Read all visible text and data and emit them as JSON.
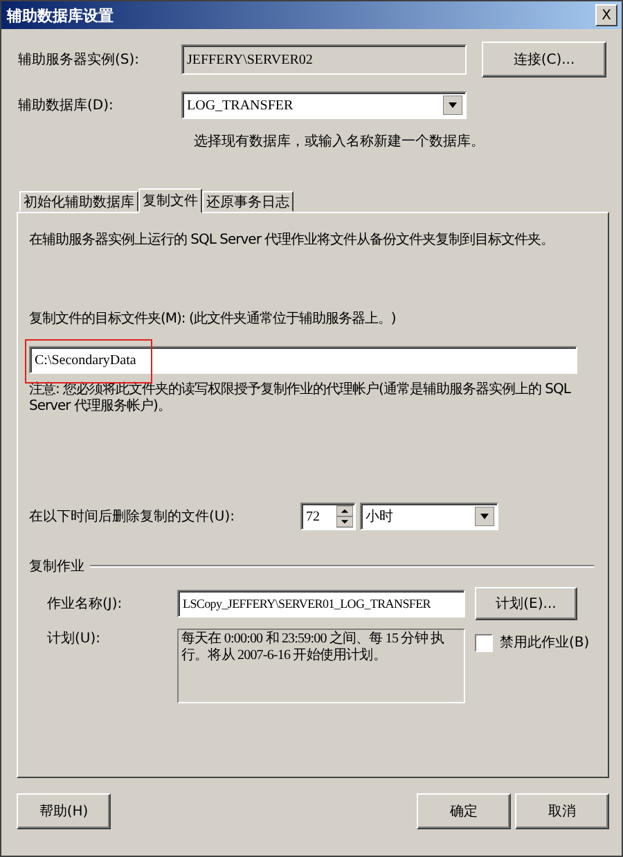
{
  "window": {
    "title": "辅助数据库设置",
    "close": "X"
  },
  "instance": {
    "label": "辅助服务器实例(S):",
    "value": "JEFFERY\\SERVER02"
  },
  "connect_button": "连接(C)...",
  "database": {
    "label": "辅助数据库(D):",
    "value": "LOG_TRANSFER",
    "hint": "选择现有数据库，或输入名称新建一个数据库。"
  },
  "tabs": [
    {
      "label": "初始化辅助数据库",
      "selected": false
    },
    {
      "label": "复制文件",
      "selected": true
    },
    {
      "label": "还原事务日志",
      "selected": false
    }
  ],
  "copy_files": {
    "description": "在辅助服务器实例上运行的 SQL Server 代理作业将文件从备份文件夹复制到目标文件夹。",
    "destination_label": "复制文件的目标文件夹(M): (此文件夹通常位于辅助服务器上。)",
    "destination_value": "C:\\SecondaryData",
    "note": "注意: 您必须将此文件夹的读写权限授予复制作业的代理帐户(通常是辅助服务器实例上的 SQL Server 代理服务帐户)。",
    "delete_label": "在以下时间后删除复制的文件(U):",
    "delete_value": "72",
    "delete_unit": "小时"
  },
  "copy_job": {
    "heading": "复制作业",
    "job_name_label": "作业名称(J):",
    "job_name_value": "LSCopy_JEFFERY\\SERVER01_LOG_TRANSFER",
    "schedule_button": "计划(E)...",
    "schedule_label": "计划(U):",
    "schedule_text": "每天在 0:00:00 和 23:59:00 之间、每 15 分钟 执行。将从 2007-6-16 开始使用计划。",
    "disable_job": {
      "label": "禁用此作业(B)",
      "checked": false
    }
  },
  "buttons": {
    "help": "帮助(H)",
    "ok": "确定",
    "cancel": "取消"
  }
}
